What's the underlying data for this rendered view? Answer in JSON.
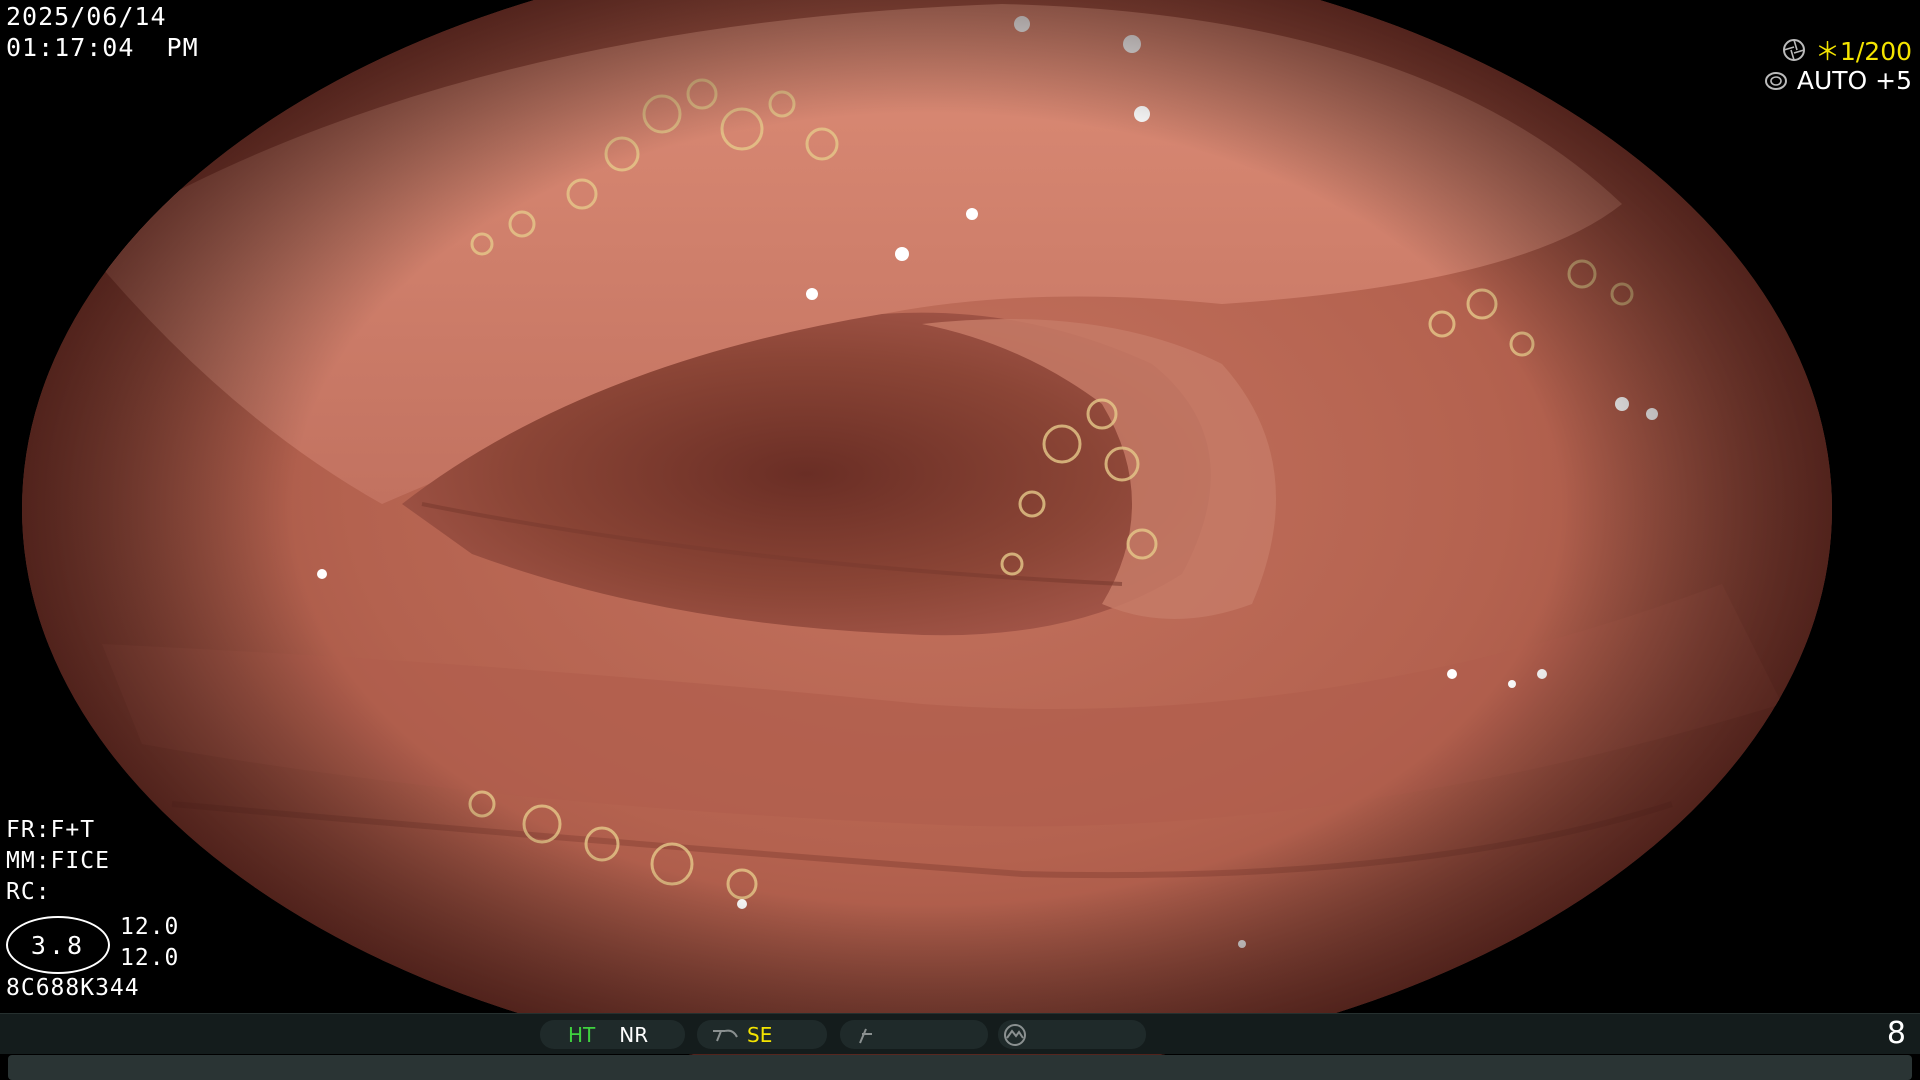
{
  "datetime": {
    "date": "2025/06/14",
    "time": "01:17:04  PM"
  },
  "top_right": {
    "shutter": "＊1/200",
    "iris": "AUTO +5"
  },
  "left_info": {
    "fr": "FR:F+T",
    "mm": "MM:FICE",
    "rc": "RC:",
    "ratio": "3.8",
    "val1": "12.0",
    "val2": "12.0",
    "serial": "8C688K344"
  },
  "status_bar": {
    "ht": "HT",
    "nr": "NR",
    "se": "SE",
    "page": "8"
  },
  "colors": {
    "ht": "#3fd13f",
    "se": "#f4e400",
    "shutter": "#f4e400"
  },
  "icons": {
    "shutter_icon": "aperture-icon",
    "iris_icon": "iris-icon",
    "se_icon": "structure-enhance-icon",
    "pen_icon": "pen-icon",
    "tone_icon": "tone-icon"
  }
}
